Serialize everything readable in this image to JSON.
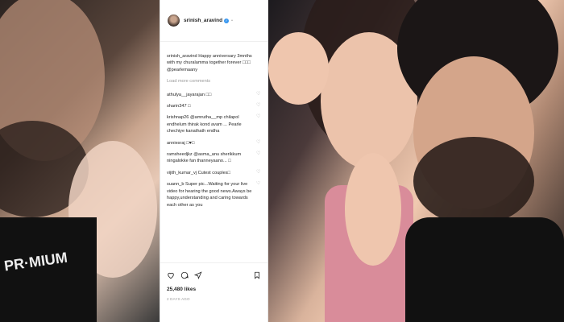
{
  "post": {
    "username": "srinish_aravind",
    "caption_user": "srinish_aravind",
    "caption_text": "Happy anniversary 3mnths with my churalamma together forever □□□ @pearlemaany",
    "load_more": "Load more comments",
    "comments": [
      {
        "user": "athulya__jayarajan",
        "text": "□□"
      },
      {
        "user": "sharin347",
        "text": "□"
      },
      {
        "user": "krishnap26",
        "text": "@amrutha__mp chilapol endhelum thirak kond avam ... Pearle chechiye kanathath endha"
      },
      {
        "user": "anniesraj",
        "text": "□♥□"
      },
      {
        "user": "ramsheedjkz",
        "text": "@asma_anu sherikkum ningalokke fan thanneyaano... □"
      },
      {
        "user": "vijith_kumar_vj",
        "text": "Cutest couples□"
      },
      {
        "user": "suann_b",
        "text": "Super pic...Waiting for your live video for hearing the good news.Aways be happy,understanding and caring towards each other as you"
      }
    ],
    "likes": "25,480 likes",
    "time_ago": "2 DAYS AGO"
  },
  "icons": {
    "heart": "heart-icon",
    "comment": "comment-icon",
    "share": "share-icon",
    "bookmark": "bookmark-icon",
    "verified": "verified-badge-icon"
  },
  "colors": {
    "verified": "#3897f0",
    "text": "#262626",
    "muted": "#999999"
  }
}
